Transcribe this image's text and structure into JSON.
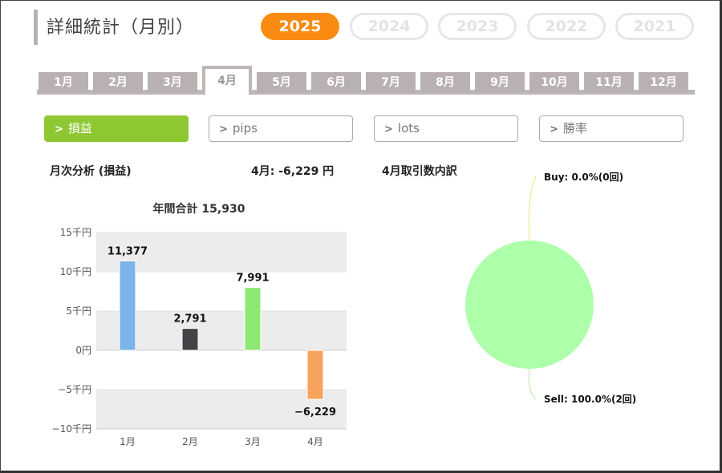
{
  "header": {
    "title": "詳細統計（月別）"
  },
  "years": [
    {
      "label": "2025",
      "active": true
    },
    {
      "label": "2024",
      "active": false
    },
    {
      "label": "2023",
      "active": false
    },
    {
      "label": "2022",
      "active": false
    },
    {
      "label": "2021",
      "active": false
    }
  ],
  "months": [
    "1月",
    "2月",
    "3月",
    "4月",
    "5月",
    "6月",
    "7月",
    "8月",
    "9月",
    "10月",
    "11月",
    "12月"
  ],
  "active_month": "4月",
  "metrics": [
    {
      "label": "損益",
      "active": true
    },
    {
      "label": "pips",
      "active": false
    },
    {
      "label": "lots",
      "active": false
    },
    {
      "label": "勝率",
      "active": false
    }
  ],
  "summary": {
    "section_title": "月次分析 (損益)",
    "month_result": "4月:  -6,229 円",
    "breakdown_title": "4月取引数内訳"
  },
  "chart_data": [
    {
      "type": "bar",
      "title": "年間合計 15,930",
      "categories": [
        "1月",
        "2月",
        "3月",
        "4月"
      ],
      "values": [
        11377,
        2791,
        7991,
        -6229
      ],
      "value_labels": [
        "11,377",
        "2,791",
        "7,991",
        "−6,229"
      ],
      "colors": [
        "#7cb4ea",
        "#434348",
        "#8ee874",
        "#f7a35c"
      ],
      "yticks": [
        15000,
        10000,
        5000,
        0,
        -5000,
        -10000
      ],
      "ytick_labels": [
        "15千円",
        "10千円",
        "5千円",
        "0円",
        "−5千円",
        "−10千円"
      ],
      "ylim": [
        -10000,
        15000
      ],
      "xlabel": "",
      "ylabel": ""
    },
    {
      "type": "pie",
      "labels": [
        "Buy: 0.0%(0回)",
        "Sell: 100.0%(2回)"
      ],
      "values": [
        0,
        2
      ],
      "percent": [
        0.0,
        100.0
      ],
      "colors": [
        "#ffb3b3",
        "#adffaa"
      ]
    }
  ]
}
